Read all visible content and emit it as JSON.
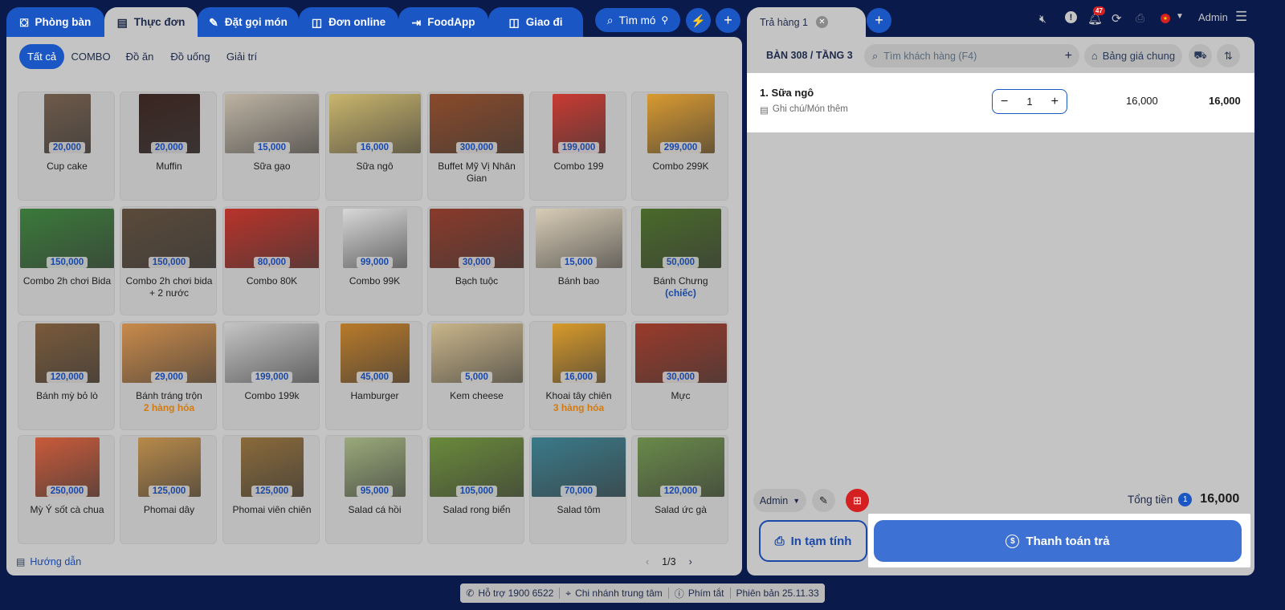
{
  "top_tabs": [
    {
      "label": "Phòng bàn",
      "icon": "table-icon"
    },
    {
      "label": "Thực đơn",
      "icon": "menu-book-icon"
    },
    {
      "label": "Đặt gọi món",
      "icon": "order-edit-icon"
    },
    {
      "label": "Đơn online",
      "icon": "shopping-bag-icon"
    },
    {
      "label": "FoodApp",
      "icon": "app-login-icon"
    },
    {
      "label": "Giao đi",
      "icon": "delivery-bag-icon"
    }
  ],
  "search_button": {
    "label": "Tìm mó",
    "icon": "search-icon"
  },
  "categories": [
    "Tất cả",
    "COMBO",
    "Đồ ăn",
    "Đồ uống",
    "Giải trí"
  ],
  "products": [
    {
      "name": "Cup cake",
      "price": "20,000",
      "sub": "",
      "color": "#6e5a4a"
    },
    {
      "name": "Muffin",
      "price": "20,000",
      "sub": "",
      "color": "#3a2520"
    },
    {
      "name": "Sữa gạo",
      "price": "15,000",
      "sub": "",
      "color": "#bdb3a3"
    },
    {
      "name": "Sữa ngô",
      "price": "16,000",
      "sub": "",
      "color": "#c9b56c"
    },
    {
      "name": "Buffet Mỹ Vị Nhân Gian",
      "price": "300,000",
      "sub": "",
      "color": "#8a4a2a"
    },
    {
      "name": "Combo 199",
      "price": "199,000",
      "sub": "",
      "color": "#c93a32"
    },
    {
      "name": "Combo 299K",
      "price": "299,000",
      "sub": "",
      "color": "#d99a30"
    },
    {
      "name": "Combo 2h chơi Bida",
      "price": "150,000",
      "sub": "",
      "color": "#3a7a3a"
    },
    {
      "name": "Combo 2h chơi bida + 2 nước",
      "price": "150,000",
      "sub": "",
      "color": "#5a4a3a"
    },
    {
      "name": "Combo 80K",
      "price": "80,000",
      "sub": "",
      "color": "#b8332a"
    },
    {
      "name": "Combo 99K",
      "price": "99,000",
      "sub": "",
      "color": "#d8d8d8"
    },
    {
      "name": "Bạch tuộc",
      "price": "30,000",
      "sub": "",
      "color": "#8a3a2a"
    },
    {
      "name": "Bánh bao",
      "price": "15,000",
      "sub": "",
      "color": "#d8ccb6"
    },
    {
      "name": "Bánh Chưng",
      "price": "50,000",
      "sub": "(chiếc)",
      "sub_color": "#1a48a8",
      "color": "#4a6a2a"
    },
    {
      "name": "Bánh mỳ bỏ lò",
      "price": "120,000",
      "sub": "",
      "color": "#7a5a3a"
    },
    {
      "name": "Bánh tráng trộn",
      "price": "29,000",
      "sub": "2 hàng hóa",
      "sub_color": "#d47a10",
      "color": "#c98a4a"
    },
    {
      "name": "Combo 199k",
      "price": "199,000",
      "sub": "",
      "color": "#c4c4c4"
    },
    {
      "name": "Hamburger",
      "price": "45,000",
      "sub": "",
      "color": "#b87a2a"
    },
    {
      "name": "Kem cheese",
      "price": "5,000",
      "sub": "",
      "color": "#c9b58a"
    },
    {
      "name": "Khoai tây chiên",
      "price": "16,000",
      "sub": "3 hàng hóa",
      "sub_color": "#d47a10",
      "color": "#d89a2a"
    },
    {
      "name": "Mực",
      "price": "30,000",
      "sub": "",
      "color": "#9a3a2a"
    },
    {
      "name": "Mỳ Ý sốt cà chua",
      "price": "250,000",
      "sub": "",
      "color": "#c95a3a"
    },
    {
      "name": "Phomai dây",
      "price": "125,000",
      "sub": "",
      "color": "#b88a4a"
    },
    {
      "name": "Phomai viên chiên",
      "price": "125,000",
      "sub": "",
      "color": "#8a6a3a"
    },
    {
      "name": "Salad cá hồi",
      "price": "95,000",
      "sub": "",
      "color": "#9aaa7a"
    },
    {
      "name": "Salad rong biển",
      "price": "105,000",
      "sub": "",
      "color": "#6a8a3a"
    },
    {
      "name": "Salad tôm",
      "price": "70,000",
      "sub": "",
      "color": "#3a7a8a"
    },
    {
      "name": "Salad ức gà",
      "price": "120,000",
      "sub": "",
      "color": "#6a8a4a"
    }
  ],
  "guide_link": "Hướng dẫn",
  "pagination": {
    "text": "1/3"
  },
  "order_tab": {
    "label": "Trả hàng 1"
  },
  "table_label": "BÀN 308 / TẦNG 3",
  "customer_search": {
    "placeholder": "Tìm khách hàng (F4)"
  },
  "price_list": "Bảng giá chung",
  "notifications": {
    "count": "47"
  },
  "user": "Admin",
  "order_items": [
    {
      "name": "1. Sữa ngô",
      "note": "Ghi chú/Món thêm",
      "qty": "1",
      "unit_price": "16,000",
      "total": "16,000"
    }
  ],
  "staff_select": "Admin",
  "total": {
    "label": "Tổng tiền",
    "count": "1",
    "value": "16,000"
  },
  "actions": {
    "print": "In tạm tính",
    "pay": "Thanh toán trả"
  },
  "footer": {
    "support": "Hỗ trợ 1900 6522",
    "branch": "Chi nhánh trung tâm",
    "shortcuts": "Phím tắt",
    "version": "Phiên bản 25.11.33"
  },
  "colors": {
    "primary": "#1a56c4",
    "background": "#0a1a4a",
    "panel": "#c4c4c4",
    "alert": "#d42020"
  }
}
